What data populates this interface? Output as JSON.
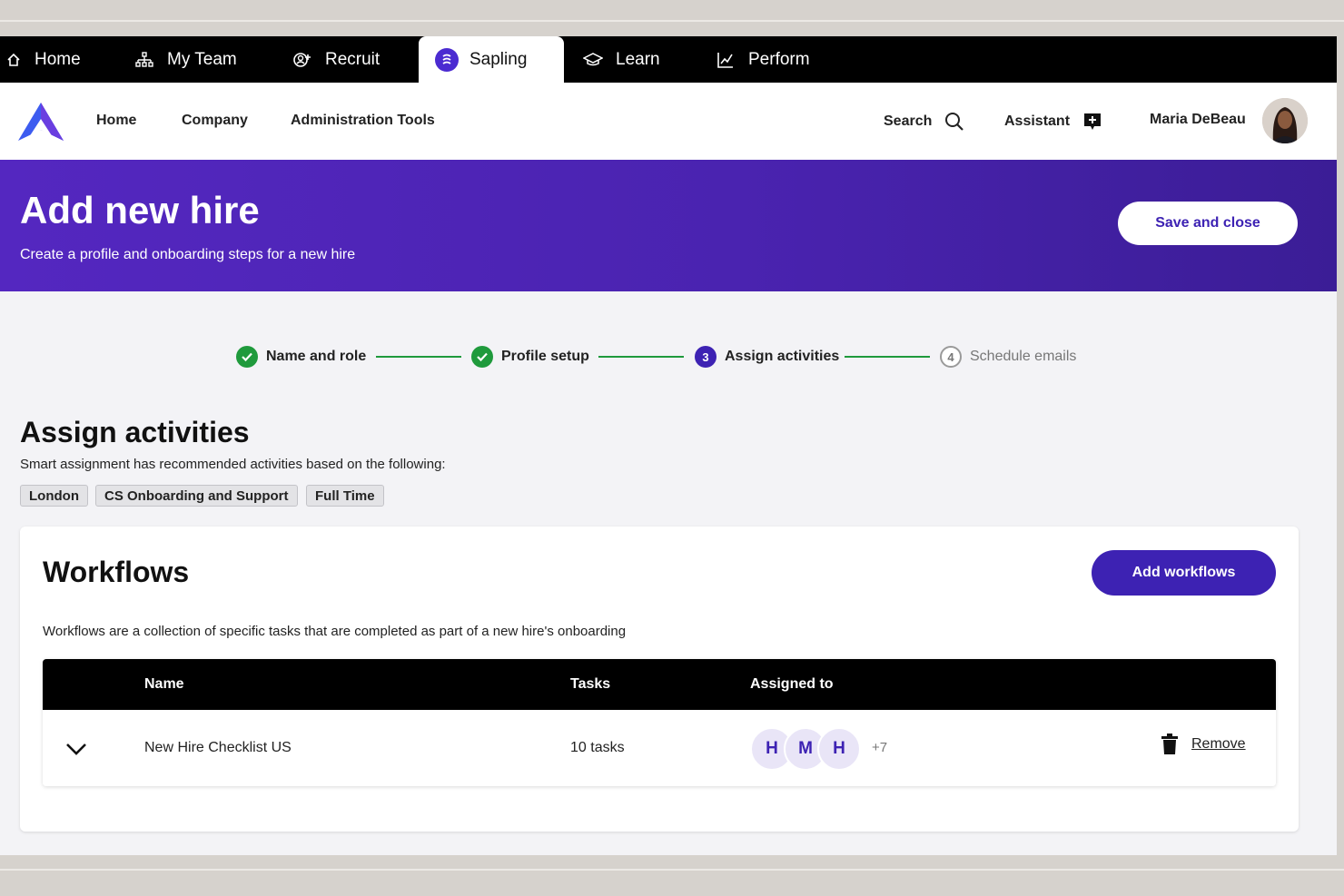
{
  "app_tabs": [
    {
      "label": "Home",
      "icon": "home-icon"
    },
    {
      "label": "My Team",
      "icon": "team-icon"
    },
    {
      "label": "Recruit",
      "icon": "recruit-icon"
    },
    {
      "label": "Sapling",
      "icon": "sapling-icon",
      "active": true
    },
    {
      "label": "Learn",
      "icon": "graduation-cap-icon"
    },
    {
      "label": "Perform",
      "icon": "chart-icon"
    }
  ],
  "nav": {
    "links": [
      "Home",
      "Company",
      "Administration Tools"
    ],
    "search_label": "Search",
    "assistant_label": "Assistant",
    "user_name": "Maria DeBeau"
  },
  "hero": {
    "title": "Add new hire",
    "subtitle": "Create a profile and onboarding steps for a new hire",
    "save_label": "Save and close"
  },
  "stepper": {
    "steps": [
      {
        "label": "Name and role",
        "status": "complete",
        "number": "1"
      },
      {
        "label": "Profile setup",
        "status": "complete",
        "number": "2"
      },
      {
        "label": "Assign activities",
        "status": "current",
        "number": "3"
      },
      {
        "label": "Schedule emails",
        "status": "upcoming",
        "number": "4"
      }
    ]
  },
  "section": {
    "title": "Assign activities",
    "description": "Smart assignment has recommended activities based on the following:",
    "tags": [
      "London",
      "CS Onboarding and Support",
      "Full Time"
    ]
  },
  "workflows": {
    "title": "Workflows",
    "add_label": "Add workflows",
    "description": "Workflows are a collection of specific tasks that are completed as part of a new hire's onboarding",
    "columns": [
      "Name",
      "Tasks",
      "Assigned to"
    ],
    "rows": [
      {
        "name": "New Hire Checklist US",
        "tasks": "10 tasks",
        "assignees": [
          "H",
          "M",
          "H"
        ],
        "more": "+7",
        "remove_label": "Remove"
      }
    ]
  },
  "colors": {
    "brand": "#3d22b3",
    "hero_gradient_start": "#5427c0",
    "success": "#1f9a3c"
  }
}
